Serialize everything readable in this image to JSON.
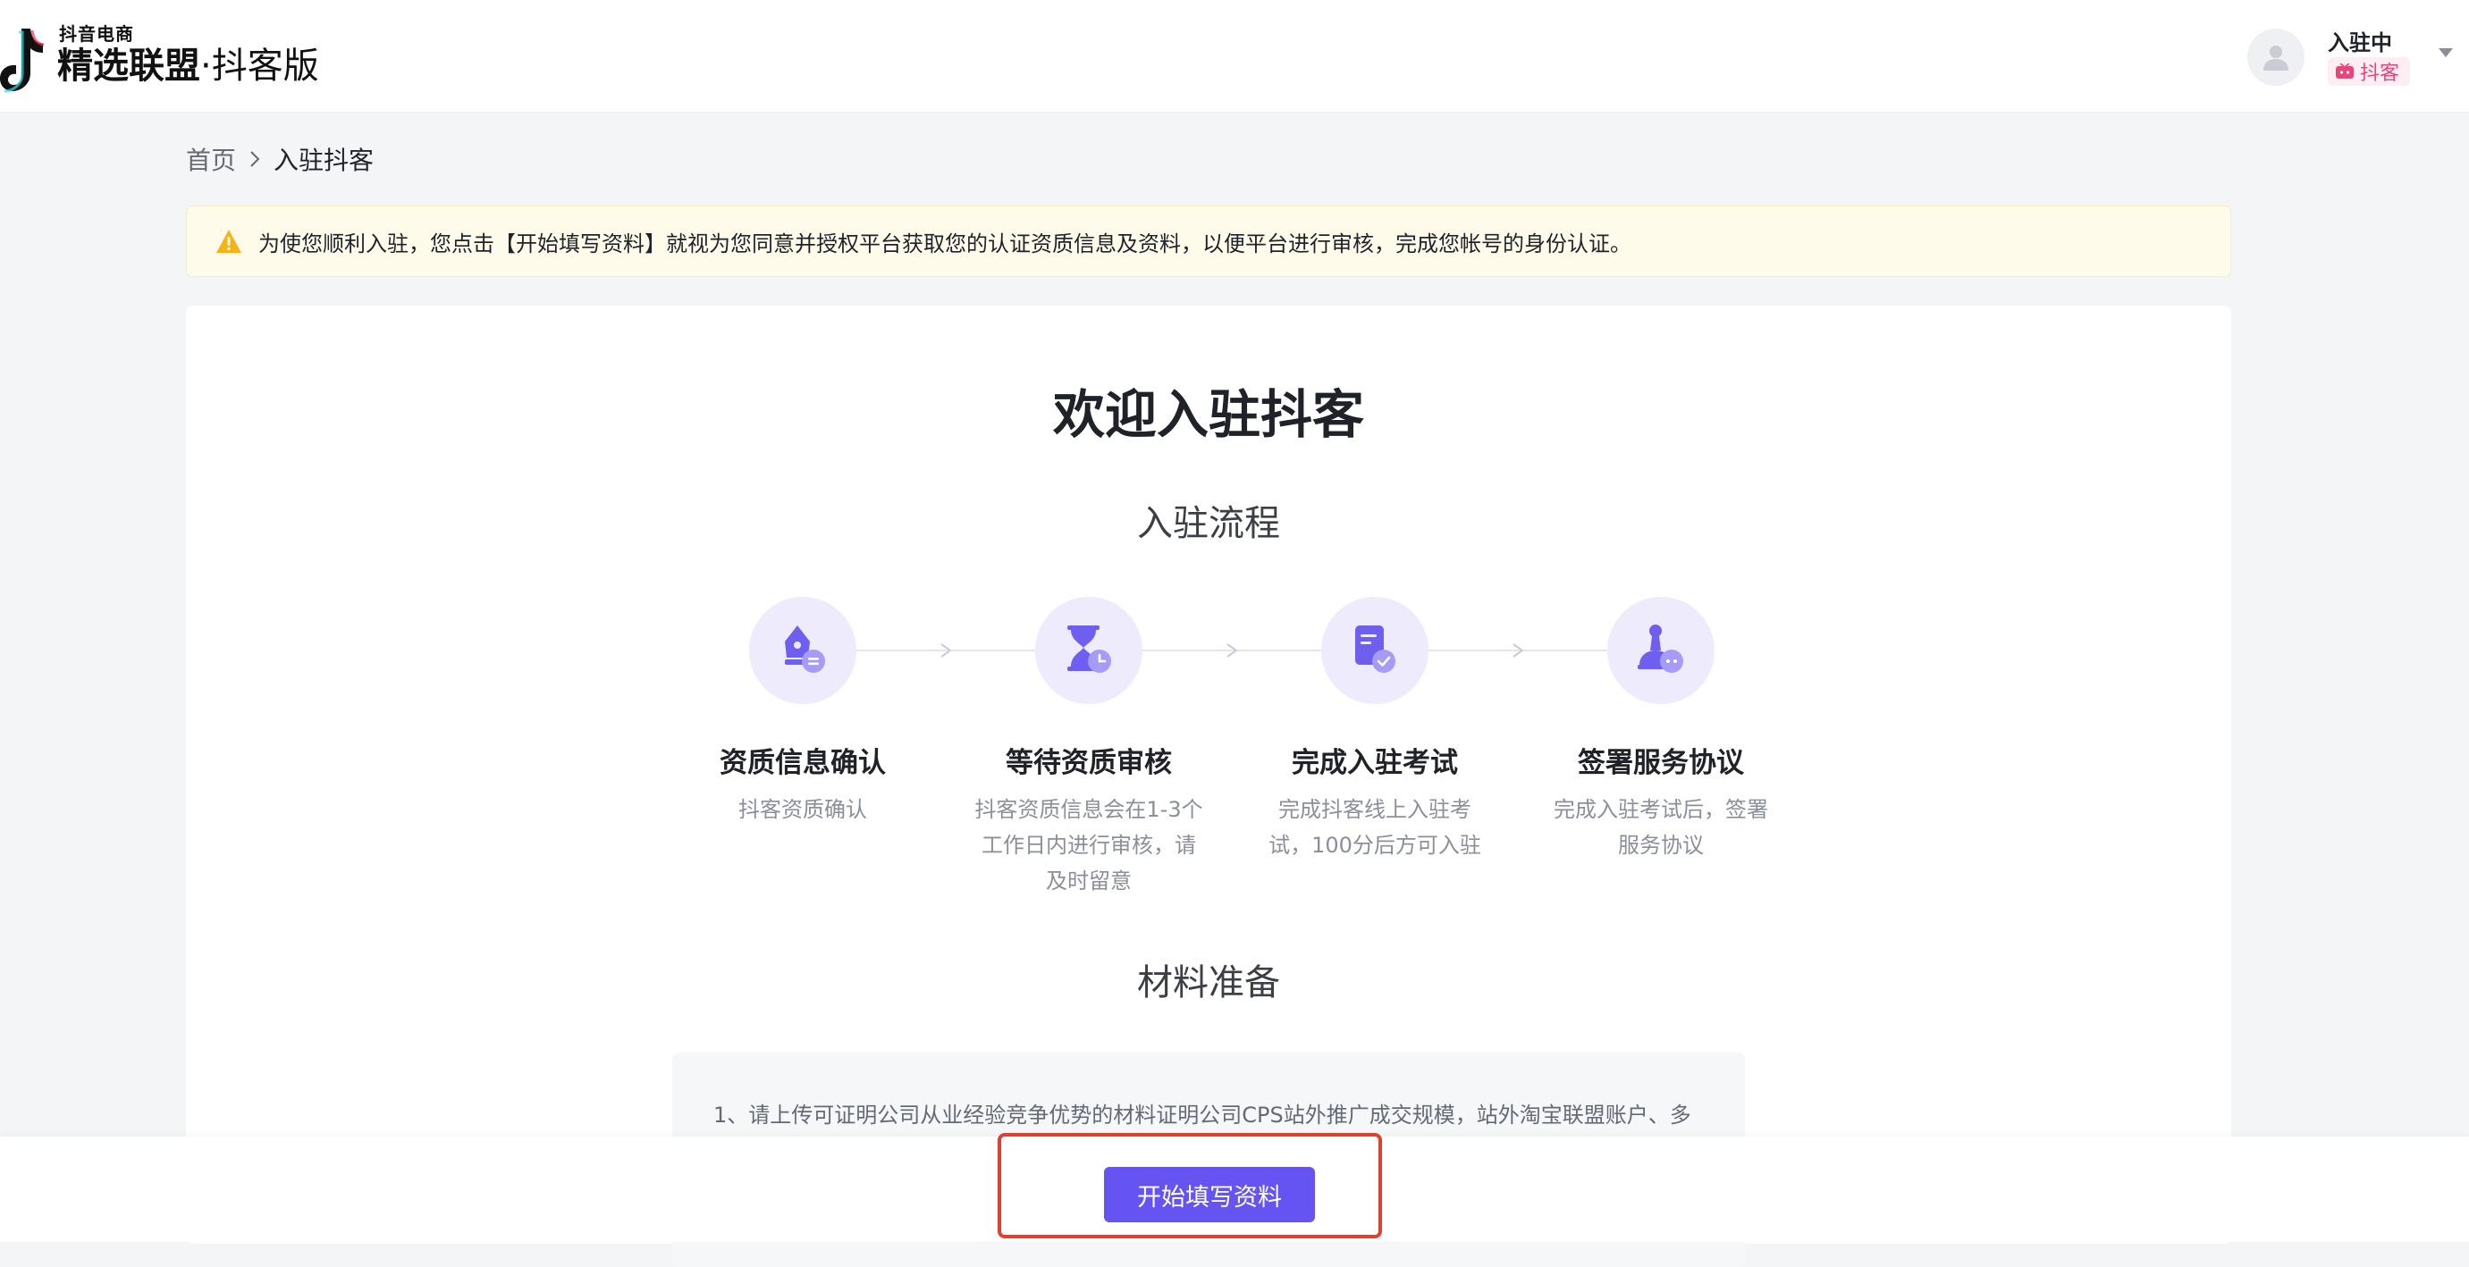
{
  "header": {
    "logo_small": "抖音电商",
    "logo_main": "精选联盟",
    "logo_sep": "·",
    "logo_sub": "抖客版",
    "user_status": "入驻中",
    "user_tag": "抖客"
  },
  "breadcrumb": {
    "home": "首页",
    "current": "入驻抖客"
  },
  "notice": {
    "text": "为使您顺利入驻，您点击【开始填写资料】就视为您同意并授权平台获取您的认证资质信息及资料，以便平台进行审核，完成您帐号的身份认证。"
  },
  "main": {
    "welcome": "欢迎入驻抖客",
    "flow_title": "入驻流程",
    "steps": [
      {
        "title": "资质信息确认",
        "desc": "抖客资质确认",
        "icon": "pen-nib-icon"
      },
      {
        "title": "等待资质审核",
        "desc": "抖客资质信息会在1-3个工作日内进行审核，请及时留意",
        "icon": "hourglass-clock-icon"
      },
      {
        "title": "完成入驻考试",
        "desc": "完成抖客线上入驻考试，100分后方可入驻",
        "icon": "document-check-icon"
      },
      {
        "title": "签署服务协议",
        "desc": "完成入驻考试后，签署服务协议",
        "icon": "stamp-icon"
      }
    ],
    "material_title": "材料准备",
    "material_text": "1、请上传可证明公司从业经验竞争优势的材料证明公司CPS站外推广成交规模，站外淘宝联盟账户、多"
  },
  "footer": {
    "start_button": "开始填写资料"
  },
  "colors": {
    "primary": "#6554f1",
    "icon_bg": "#eeecfc",
    "notice_bg": "#fffbeb",
    "warning": "#f5b315",
    "highlight_border": "#e0402f",
    "tag_text": "#e8457c"
  }
}
